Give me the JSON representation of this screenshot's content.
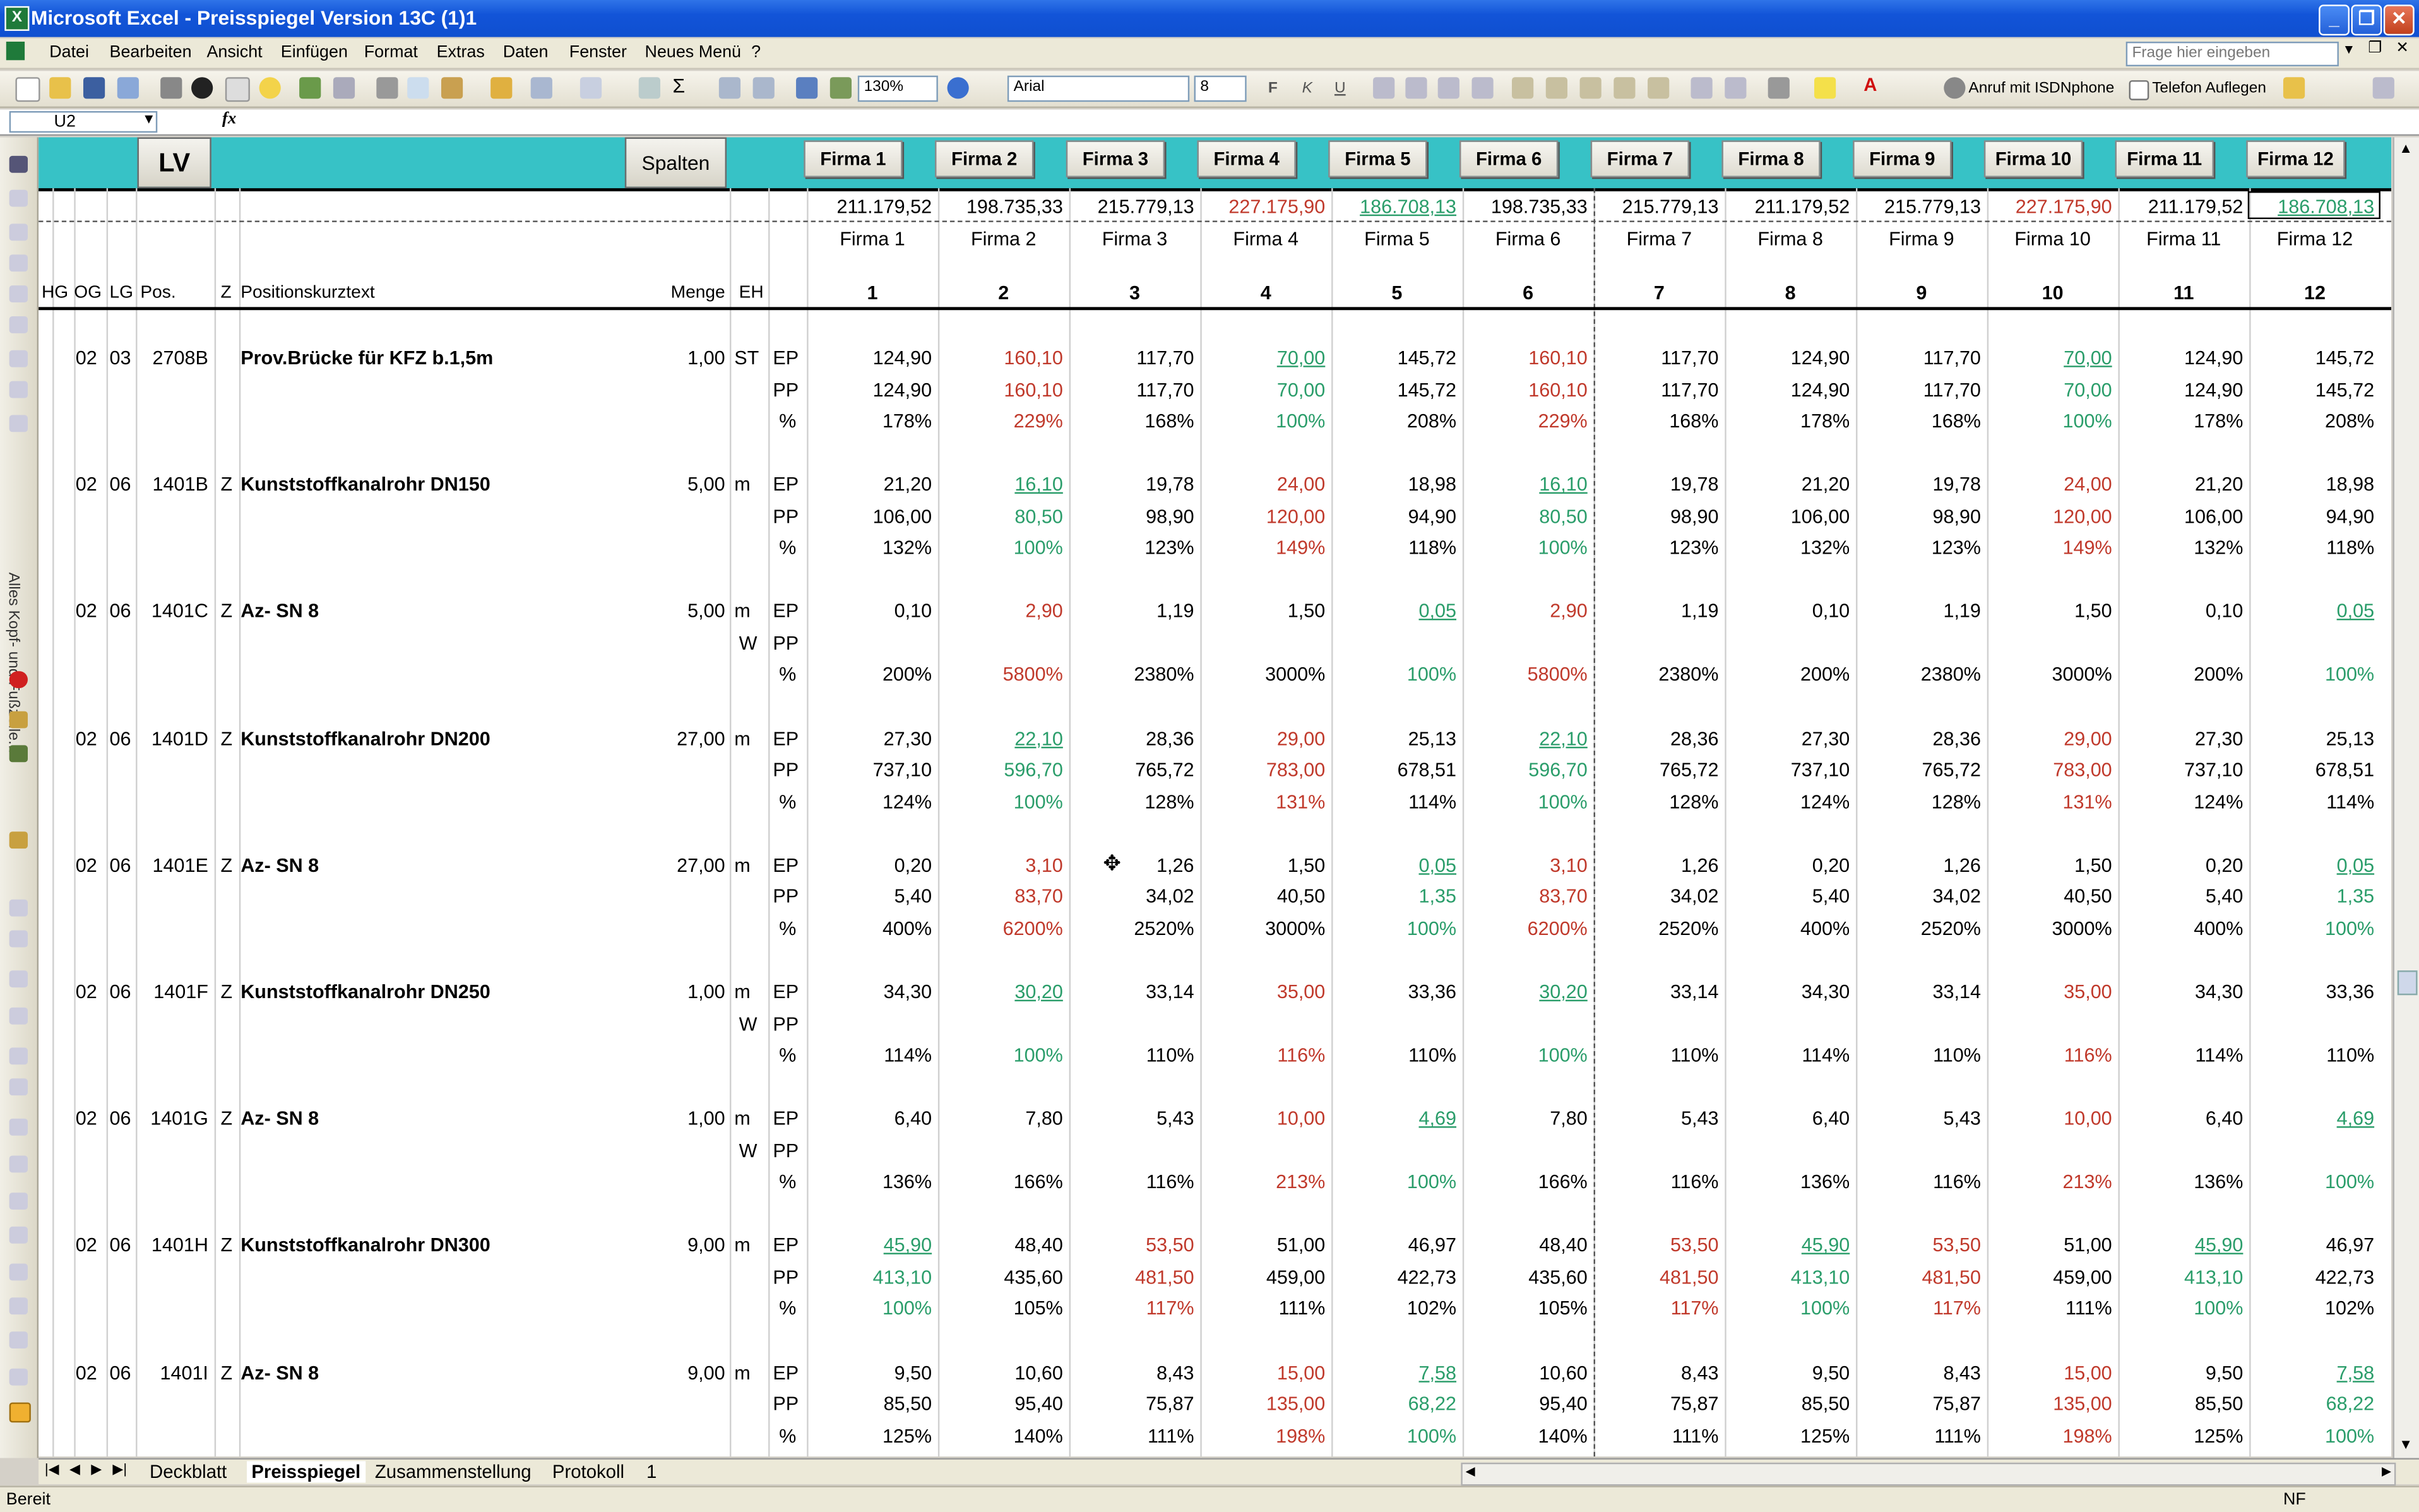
{
  "window": {
    "title": "Microsoft Excel - Preisspiegel  Version 13C (1)1",
    "minimize": "_",
    "restore": "❐",
    "close": "✕"
  },
  "menu": {
    "items": [
      "Datei",
      "Bearbeiten",
      "Ansicht",
      "Einfügen",
      "Format",
      "Extras",
      "Daten",
      "Fenster",
      "Neues Menü",
      "?"
    ],
    "help_placeholder": "Frage hier eingeben"
  },
  "toolbar": {
    "zoom": "130%",
    "font": "Arial",
    "size": "8",
    "bold": "F",
    "italic": "K",
    "underline": "U",
    "call_label": "Anruf mit ISDNphone",
    "hangup_label": "Telefon Auflegen"
  },
  "formula_bar": {
    "cell_ref": "U2",
    "fx": "fx",
    "value": ""
  },
  "left_toolbar": {
    "vertical_label": "Alles Kopf- und Fußzeile..."
  },
  "sheet": {
    "lv_button": "LV",
    "spalten_button": "Spalten",
    "firm_buttons": [
      "Firma 1",
      "Firma 2",
      "Firma 3",
      "Firma 4",
      "Firma 5",
      "Firma 6",
      "Firma 7",
      "Firma 8",
      "Firma 9",
      "Firma 10",
      "Firma 11",
      "Firma 12"
    ],
    "totals": [
      {
        "v": "211.179,52",
        "c": ""
      },
      {
        "v": "198.735,33",
        "c": ""
      },
      {
        "v": "215.779,13",
        "c": ""
      },
      {
        "v": "227.175,90",
        "c": "red"
      },
      {
        "v": "186.708,13",
        "c": "grn ul"
      },
      {
        "v": "198.735,33",
        "c": ""
      },
      {
        "v": "215.779,13",
        "c": ""
      },
      {
        "v": "211.179,52",
        "c": ""
      },
      {
        "v": "215.779,13",
        "c": ""
      },
      {
        "v": "227.175,90",
        "c": "red"
      },
      {
        "v": "211.179,52",
        "c": ""
      },
      {
        "v": "186.708,13",
        "c": "grn ul"
      }
    ],
    "firm_names": [
      "Firma 1",
      "Firma 2",
      "Firma 3",
      "Firma 4",
      "Firma 5",
      "Firma 6",
      "Firma 7",
      "Firma 8",
      "Firma 9",
      "Firma 10",
      "Firma 11",
      "Firma 12"
    ],
    "headers": {
      "hg": "HG",
      "og": "OG",
      "lg": "LG",
      "pos": "Pos.",
      "z": "Z",
      "text": "Positionskurztext",
      "menge": "Menge",
      "eh": "EH",
      "numbers": [
        "1",
        "2",
        "3",
        "4",
        "5",
        "6",
        "7",
        "8",
        "9",
        "10",
        "11",
        "12"
      ]
    },
    "positions": [
      {
        "og": "02",
        "lg": "03",
        "pos": "2708B",
        "z": "",
        "text": "Prov.Brücke für KFZ b.1,5m",
        "menge": "1,00",
        "eh": "ST",
        "w": "",
        "ep": [
          "124,90",
          "160,10",
          "117,70",
          "70,00",
          "145,72",
          "160,10",
          "117,70",
          "124,90",
          "117,70",
          "70,00",
          "124,90",
          "145,72"
        ],
        "ep_c": [
          "",
          "red",
          "",
          "grn ul",
          "",
          "red",
          "",
          "",
          "",
          "grn ul",
          "",
          ""
        ],
        "pp": [
          "124,90",
          "160,10",
          "117,70",
          "70,00",
          "145,72",
          "160,10",
          "117,70",
          "124,90",
          "117,70",
          "70,00",
          "124,90",
          "145,72"
        ],
        "pp_c": [
          "",
          "red",
          "",
          "grn",
          "",
          "red",
          "",
          "",
          "",
          "grn",
          "",
          ""
        ],
        "pct": [
          "178%",
          "229%",
          "168%",
          "100%",
          "208%",
          "229%",
          "168%",
          "178%",
          "168%",
          "100%",
          "178%",
          "208%"
        ],
        "pct_c": [
          "",
          "red",
          "",
          "grn",
          "",
          "red",
          "",
          "",
          "",
          "grn",
          "",
          ""
        ]
      },
      {
        "og": "02",
        "lg": "06",
        "pos": "1401B",
        "z": "Z",
        "text": "Kunststoffkanalrohr DN150",
        "menge": "5,00",
        "eh": "m",
        "w": "",
        "ep": [
          "21,20",
          "16,10",
          "19,78",
          "24,00",
          "18,98",
          "16,10",
          "19,78",
          "21,20",
          "19,78",
          "24,00",
          "21,20",
          "18,98"
        ],
        "ep_c": [
          "",
          "grn ul",
          "",
          "red",
          "",
          "grn ul",
          "",
          "",
          "",
          "red",
          "",
          ""
        ],
        "pp": [
          "106,00",
          "80,50",
          "98,90",
          "120,00",
          "94,90",
          "80,50",
          "98,90",
          "106,00",
          "98,90",
          "120,00",
          "106,00",
          "94,90"
        ],
        "pp_c": [
          "",
          "grn",
          "",
          "red",
          "",
          "grn",
          "",
          "",
          "",
          "red",
          "",
          ""
        ],
        "pct": [
          "132%",
          "100%",
          "123%",
          "149%",
          "118%",
          "100%",
          "123%",
          "132%",
          "123%",
          "149%",
          "132%",
          "118%"
        ],
        "pct_c": [
          "",
          "grn",
          "",
          "red",
          "",
          "grn",
          "",
          "",
          "",
          "red",
          "",
          ""
        ]
      },
      {
        "og": "02",
        "lg": "06",
        "pos": "1401C",
        "z": "Z",
        "text": "Az- SN 8",
        "menge": "5,00",
        "eh": "m",
        "w": "W",
        "ep": [
          "0,10",
          "2,90",
          "1,19",
          "1,50",
          "0,05",
          "2,90",
          "1,19",
          "0,10",
          "1,19",
          "1,50",
          "0,10",
          "0,05"
        ],
        "ep_c": [
          "",
          "red",
          "",
          "",
          "grn ul",
          "red",
          "",
          "",
          "",
          "",
          "",
          "grn ul"
        ],
        "pp": [
          "",
          "",
          "",
          "",
          "",
          "",
          "",
          "",
          "",
          "",
          "",
          ""
        ],
        "pp_c": [
          "",
          "",
          "",
          "",
          "",
          "",
          "",
          "",
          "",
          "",
          "",
          ""
        ],
        "pct": [
          "200%",
          "5800%",
          "2380%",
          "3000%",
          "100%",
          "5800%",
          "2380%",
          "200%",
          "2380%",
          "3000%",
          "200%",
          "100%"
        ],
        "pct_c": [
          "",
          "red",
          "",
          "",
          "grn",
          "red",
          "",
          "",
          "",
          "",
          "",
          "grn"
        ]
      },
      {
        "og": "02",
        "lg": "06",
        "pos": "1401D",
        "z": "Z",
        "text": "Kunststoffkanalrohr DN200",
        "menge": "27,00",
        "eh": "m",
        "w": "",
        "ep": [
          "27,30",
          "22,10",
          "28,36",
          "29,00",
          "25,13",
          "22,10",
          "28,36",
          "27,30",
          "28,36",
          "29,00",
          "27,30",
          "25,13"
        ],
        "ep_c": [
          "",
          "grn ul",
          "",
          "red",
          "",
          "grn ul",
          "",
          "",
          "",
          "red",
          "",
          ""
        ],
        "pp": [
          "737,10",
          "596,70",
          "765,72",
          "783,00",
          "678,51",
          "596,70",
          "765,72",
          "737,10",
          "765,72",
          "783,00",
          "737,10",
          "678,51"
        ],
        "pp_c": [
          "",
          "grn",
          "",
          "red",
          "",
          "grn",
          "",
          "",
          "",
          "red",
          "",
          ""
        ],
        "pct": [
          "124%",
          "100%",
          "128%",
          "131%",
          "114%",
          "100%",
          "128%",
          "124%",
          "128%",
          "131%",
          "124%",
          "114%"
        ],
        "pct_c": [
          "",
          "grn",
          "",
          "red",
          "",
          "grn",
          "",
          "",
          "",
          "red",
          "",
          ""
        ]
      },
      {
        "og": "02",
        "lg": "06",
        "pos": "1401E",
        "z": "Z",
        "text": "Az- SN 8",
        "menge": "27,00",
        "eh": "m",
        "w": "",
        "ep": [
          "0,20",
          "3,10",
          "1,26",
          "1,50",
          "0,05",
          "3,10",
          "1,26",
          "0,20",
          "1,26",
          "1,50",
          "0,20",
          "0,05"
        ],
        "ep_c": [
          "",
          "red",
          "",
          "",
          "grn ul",
          "red",
          "",
          "",
          "",
          "",
          "",
          "grn ul"
        ],
        "pp": [
          "5,40",
          "83,70",
          "34,02",
          "40,50",
          "1,35",
          "83,70",
          "34,02",
          "5,40",
          "34,02",
          "40,50",
          "5,40",
          "1,35"
        ],
        "pp_c": [
          "",
          "red",
          "",
          "",
          "grn",
          "red",
          "",
          "",
          "",
          "",
          "",
          "grn"
        ],
        "pct": [
          "400%",
          "6200%",
          "2520%",
          "3000%",
          "100%",
          "6200%",
          "2520%",
          "400%",
          "2520%",
          "3000%",
          "400%",
          "100%"
        ],
        "pct_c": [
          "",
          "red",
          "",
          "",
          "grn",
          "red",
          "",
          "",
          "",
          "",
          "",
          "grn"
        ]
      },
      {
        "og": "02",
        "lg": "06",
        "pos": "1401F",
        "z": "Z",
        "text": "Kunststoffkanalrohr DN250",
        "menge": "1,00",
        "eh": "m",
        "w": "W",
        "ep": [
          "34,30",
          "30,20",
          "33,14",
          "35,00",
          "33,36",
          "30,20",
          "33,14",
          "34,30",
          "33,14",
          "35,00",
          "34,30",
          "33,36"
        ],
        "ep_c": [
          "",
          "grn ul",
          "",
          "red",
          "",
          "grn ul",
          "",
          "",
          "",
          "red",
          "",
          ""
        ],
        "pp": [
          "",
          "",
          "",
          "",
          "",
          "",
          "",
          "",
          "",
          "",
          "",
          ""
        ],
        "pp_c": [
          "",
          "",
          "",
          "",
          "",
          "",
          "",
          "",
          "",
          "",
          "",
          ""
        ],
        "pct": [
          "114%",
          "100%",
          "110%",
          "116%",
          "110%",
          "100%",
          "110%",
          "114%",
          "110%",
          "116%",
          "114%",
          "110%"
        ],
        "pct_c": [
          "",
          "grn",
          "",
          "red",
          "",
          "grn",
          "",
          "",
          "",
          "red",
          "",
          ""
        ]
      },
      {
        "og": "02",
        "lg": "06",
        "pos": "1401G",
        "z": "Z",
        "text": "Az- SN 8",
        "menge": "1,00",
        "eh": "m",
        "w": "W",
        "ep": [
          "6,40",
          "7,80",
          "5,43",
          "10,00",
          "4,69",
          "7,80",
          "5,43",
          "6,40",
          "5,43",
          "10,00",
          "6,40",
          "4,69"
        ],
        "ep_c": [
          "",
          "",
          "",
          "red",
          "grn ul",
          "",
          "",
          "",
          "",
          "red",
          "",
          "grn ul"
        ],
        "pp": [
          "",
          "",
          "",
          "",
          "",
          "",
          "",
          "",
          "",
          "",
          "",
          ""
        ],
        "pp_c": [
          "",
          "",
          "",
          "",
          "",
          "",
          "",
          "",
          "",
          "",
          "",
          ""
        ],
        "pct": [
          "136%",
          "166%",
          "116%",
          "213%",
          "100%",
          "166%",
          "116%",
          "136%",
          "116%",
          "213%",
          "136%",
          "100%"
        ],
        "pct_c": [
          "",
          "",
          "",
          "red",
          "grn",
          "",
          "",
          "",
          "",
          "red",
          "",
          "grn"
        ]
      },
      {
        "og": "02",
        "lg": "06",
        "pos": "1401H",
        "z": "Z",
        "text": "Kunststoffkanalrohr DN300",
        "menge": "9,00",
        "eh": "m",
        "w": "",
        "ep": [
          "45,90",
          "48,40",
          "53,50",
          "51,00",
          "46,97",
          "48,40",
          "53,50",
          "45,90",
          "53,50",
          "51,00",
          "45,90",
          "46,97"
        ],
        "ep_c": [
          "grn ul",
          "",
          "red",
          "",
          "",
          "",
          "red",
          "grn ul",
          "red",
          "",
          "grn ul",
          ""
        ],
        "pp": [
          "413,10",
          "435,60",
          "481,50",
          "459,00",
          "422,73",
          "435,60",
          "481,50",
          "413,10",
          "481,50",
          "459,00",
          "413,10",
          "422,73"
        ],
        "pp_c": [
          "grn",
          "",
          "red",
          "",
          "",
          "",
          "red",
          "grn",
          "red",
          "",
          "grn",
          ""
        ],
        "pct": [
          "100%",
          "105%",
          "117%",
          "111%",
          "102%",
          "105%",
          "117%",
          "100%",
          "117%",
          "111%",
          "100%",
          "102%"
        ],
        "pct_c": [
          "grn",
          "",
          "red",
          "",
          "",
          "",
          "red",
          "grn",
          "red",
          "",
          "grn",
          ""
        ]
      },
      {
        "og": "02",
        "lg": "06",
        "pos": "1401I",
        "z": "Z",
        "text": "Az- SN 8",
        "menge": "9,00",
        "eh": "m",
        "w": "",
        "ep": [
          "9,50",
          "10,60",
          "8,43",
          "15,00",
          "7,58",
          "10,60",
          "8,43",
          "9,50",
          "8,43",
          "15,00",
          "9,50",
          "7,58"
        ],
        "ep_c": [
          "",
          "",
          "",
          "red",
          "grn ul",
          "",
          "",
          "",
          "",
          "red",
          "",
          "grn ul"
        ],
        "pp": [
          "85,50",
          "95,40",
          "75,87",
          "135,00",
          "68,22",
          "95,40",
          "75,87",
          "85,50",
          "75,87",
          "135,00",
          "85,50",
          "68,22"
        ],
        "pp_c": [
          "",
          "",
          "",
          "red",
          "grn",
          "",
          "",
          "",
          "",
          "red",
          "",
          "grn"
        ],
        "pct": [
          "125%",
          "140%",
          "111%",
          "198%",
          "100%",
          "140%",
          "111%",
          "125%",
          "111%",
          "198%",
          "125%",
          "100%"
        ],
        "pct_c": [
          "",
          "",
          "",
          "red",
          "grn",
          "",
          "",
          "",
          "",
          "red",
          "",
          "grn"
        ]
      }
    ],
    "row_labels": {
      "ep": "EP",
      "pp": "PP",
      "pct": "%"
    }
  },
  "tabs": {
    "items": [
      "Deckblatt",
      "Preisspiegel",
      "Zusammenstellung",
      "Protokoll",
      "1"
    ],
    "active": "Preisspiegel"
  },
  "status": {
    "left": "Bereit",
    "right": "NF"
  },
  "colors": {
    "header_band": "#37c2c6",
    "lowest": "#2a9d6a",
    "highest": "#c0392b",
    "titlebar": "#1254d8"
  }
}
